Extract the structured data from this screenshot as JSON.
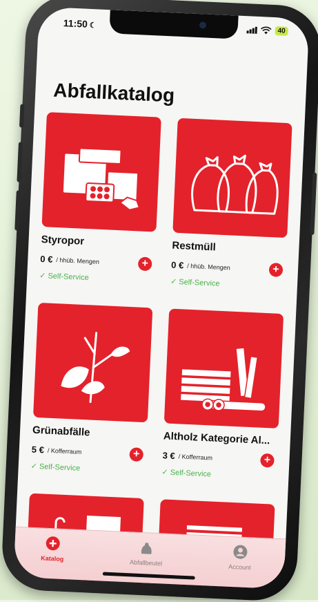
{
  "status": {
    "time": "11:50",
    "battery": "40"
  },
  "page": {
    "title": "Abfallkatalog"
  },
  "items": [
    {
      "name": "Styropor",
      "price": "0 €",
      "unit": "/ hhüb. Mengen",
      "service": "Self-Service"
    },
    {
      "name": "Restmüll",
      "price": "0 €",
      "unit": "/ hhüb. Mengen",
      "service": "Self-Service"
    },
    {
      "name": "Grünabfälle",
      "price": "5 €",
      "unit": "/ Kofferraum",
      "service": "Self-Service"
    },
    {
      "name": "Altholz Kategorie Al...",
      "price": "3 €",
      "unit": "/ Kofferraum",
      "service": "Self-Service"
    }
  ],
  "tabs": [
    {
      "label": "Katalog",
      "icon": "plus-circle-icon",
      "active": true
    },
    {
      "label": "Abfallbeutel",
      "icon": "bag-icon",
      "active": false
    },
    {
      "label": "Account",
      "icon": "person-icon",
      "active": false
    }
  ],
  "colors": {
    "accent": "#e4222b",
    "service": "#49b14a",
    "tabbar": "#f6d6d8"
  }
}
